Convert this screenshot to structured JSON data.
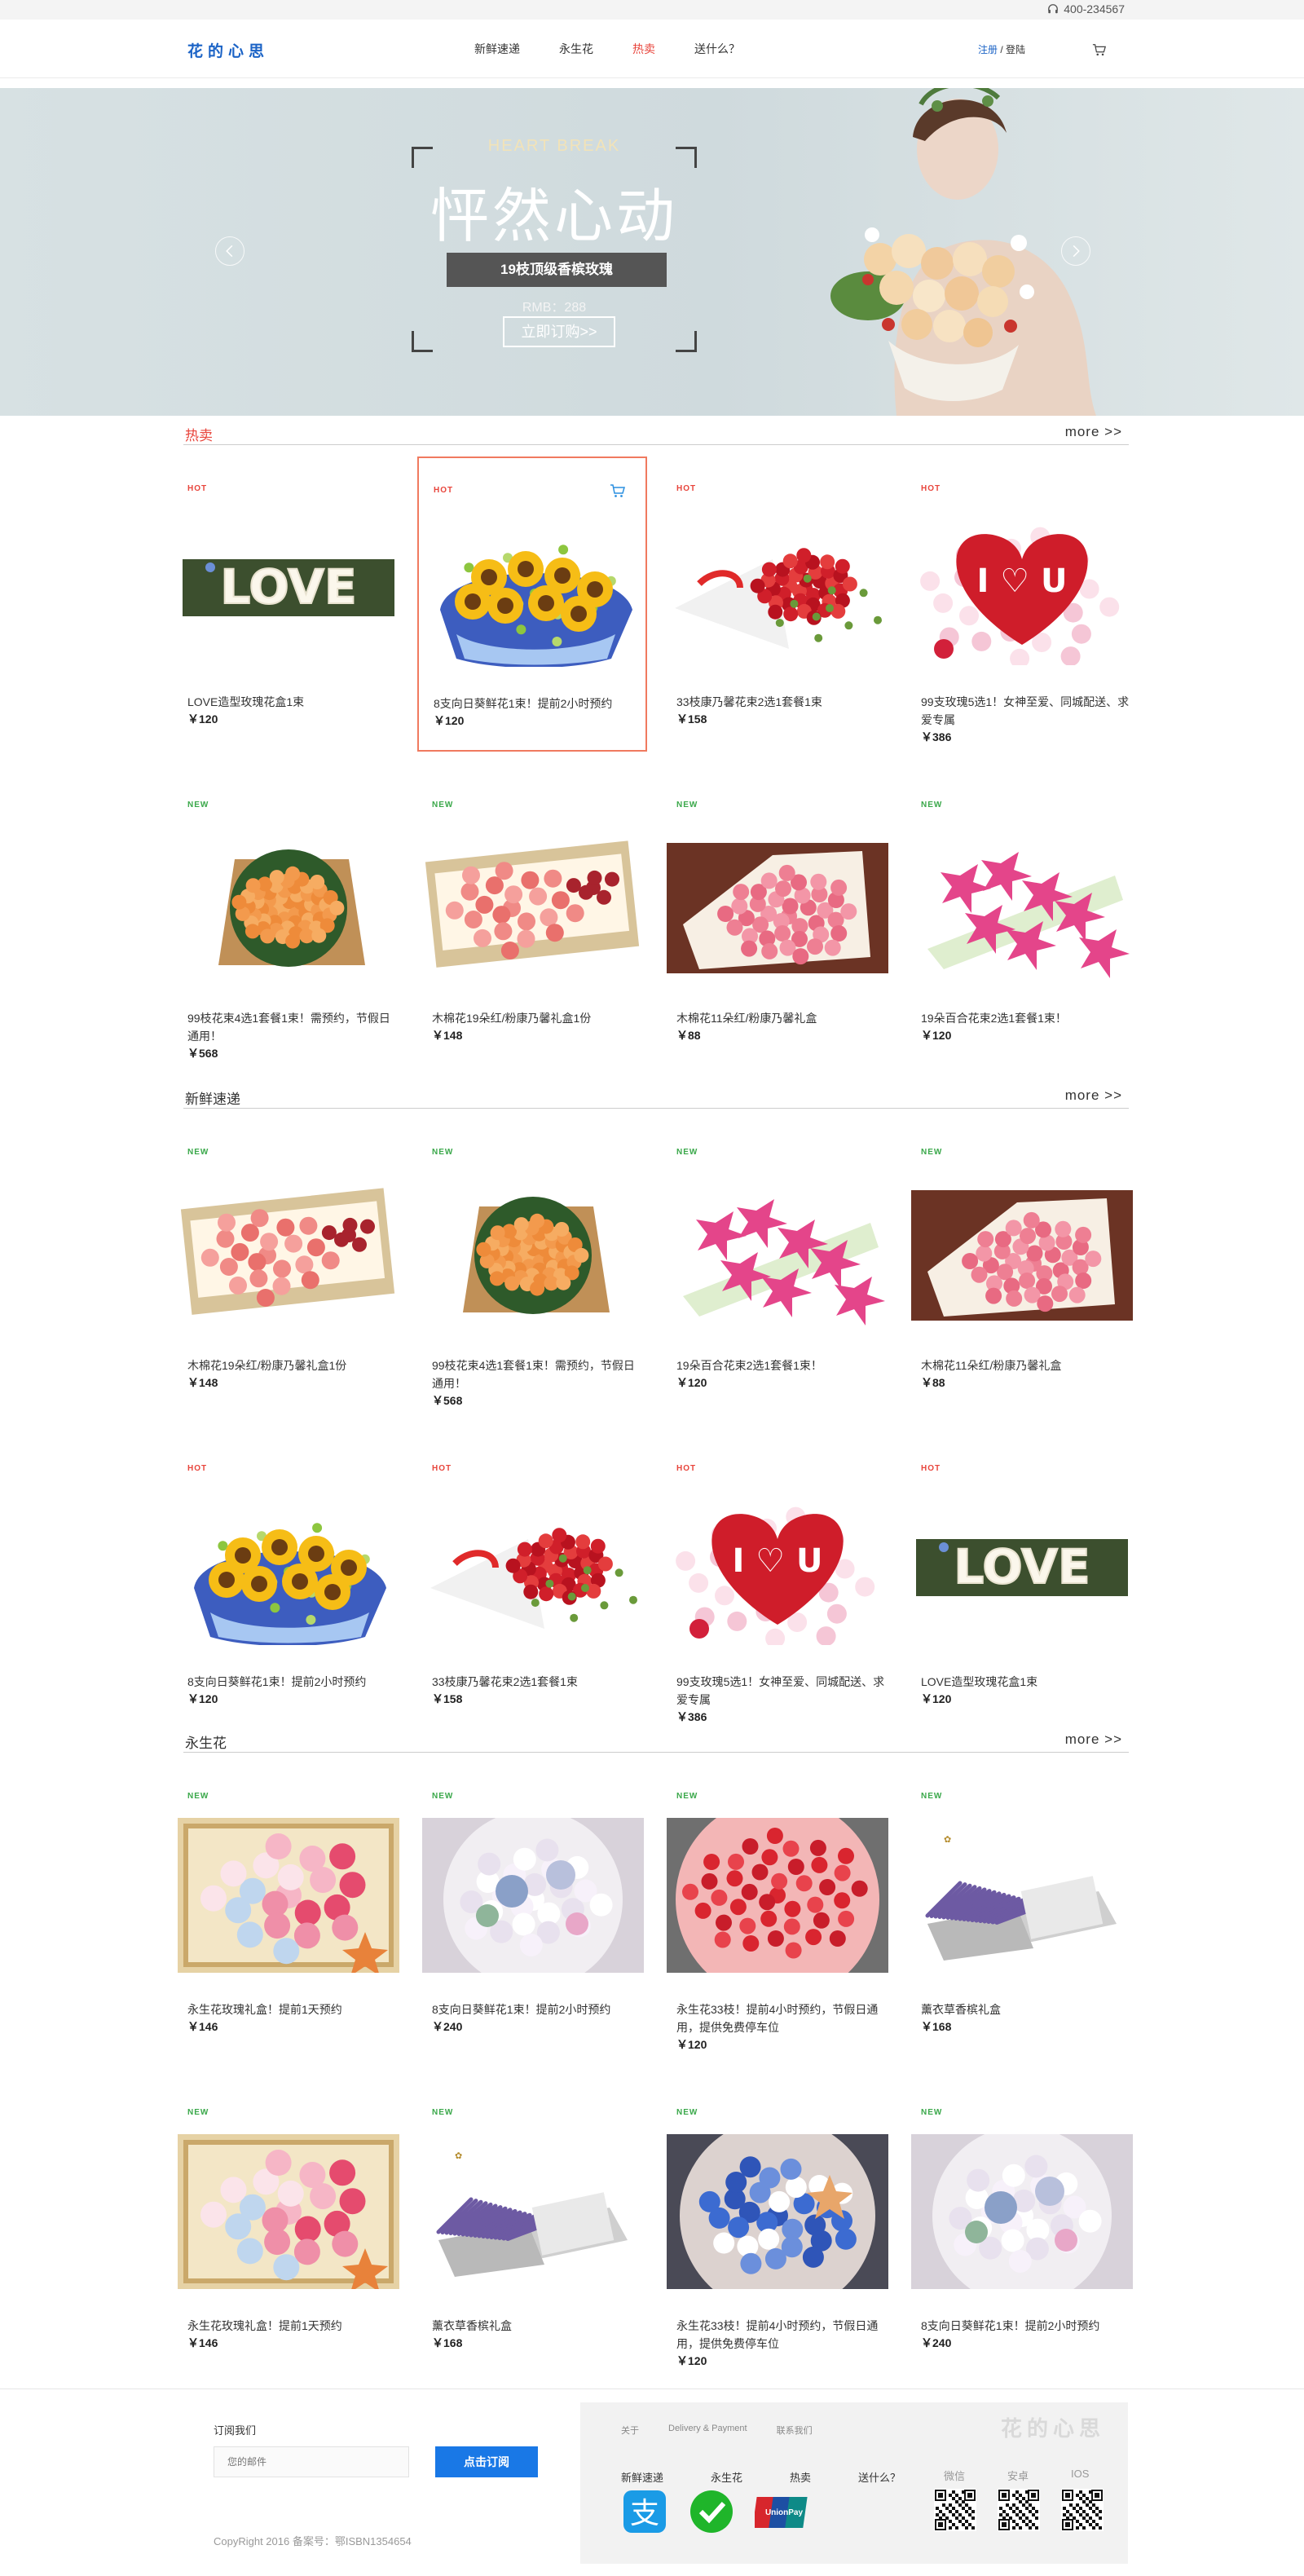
{
  "topbar": {
    "phone": "400-234567"
  },
  "header": {
    "logo": "花的心思",
    "nav": [
      {
        "label": "新鲜速递"
      },
      {
        "label": "永生花"
      },
      {
        "label": "热卖"
      },
      {
        "label": "送什么？"
      }
    ],
    "register": "注册",
    "separator": " / ",
    "login": "登陆"
  },
  "banner": {
    "eyebrow": "HEART BREAK",
    "title": "怦然心动",
    "product": "19枝顶级香槟玫瑰",
    "price": "RMB：288",
    "order_button": "立即订购>>"
  },
  "sections": [
    {
      "title": "热卖",
      "more": "more >>",
      "cards": [
        {
          "badge": "HOT",
          "name": "LOVE造型玫瑰花盒1束",
          "price": "￥120"
        },
        {
          "badge": "HOT",
          "name": "8支向日葵鲜花1束！提前2小时预约",
          "price": "￥120"
        },
        {
          "badge": "HOT",
          "name": "33枝康乃馨花束2选1套餐1束",
          "price": "￥158"
        },
        {
          "badge": "HOT",
          "name": "99支玫瑰5选1！女神至爱、同城配送、求爱专属",
          "price": "￥386"
        },
        {
          "badge": "NEW",
          "name": "99枝花束4选1套餐1束！需预约，节假日通用！",
          "price": "￥568"
        },
        {
          "badge": "NEW",
          "name": "木棉花19朵红/粉康乃馨礼盒1份",
          "price": "￥148"
        },
        {
          "badge": "NEW",
          "name": "木棉花11朵红/粉康乃馨礼盒",
          "price": "￥88"
        },
        {
          "badge": "NEW",
          "name": "19朵百合花束2选1套餐1束！",
          "price": "￥120"
        }
      ]
    },
    {
      "title": "新鲜速递",
      "more": "more >>",
      "cards": [
        {
          "badge": "NEW",
          "name": "木棉花19朵红/粉康乃馨礼盒1份",
          "price": "￥148"
        },
        {
          "badge": "NEW",
          "name": "99枝花束4选1套餐1束！需预约，节假日通用！",
          "price": "￥568"
        },
        {
          "badge": "NEW",
          "name": "19朵百合花束2选1套餐1束！",
          "price": "￥120"
        },
        {
          "badge": "NEW",
          "name": "木棉花11朵红/粉康乃馨礼盒",
          "price": "￥88"
        },
        {
          "badge": "HOT",
          "name": "8支向日葵鲜花1束！提前2小时预约",
          "price": "￥120"
        },
        {
          "badge": "HOT",
          "name": "33枝康乃馨花束2选1套餐1束",
          "price": "￥158"
        },
        {
          "badge": "HOT",
          "name": "99支玫瑰5选1！女神至爱、同城配送、求爱专属",
          "price": "￥386"
        },
        {
          "badge": "HOT",
          "name": "LOVE造型玫瑰花盒1束",
          "price": "￥120"
        }
      ]
    },
    {
      "title": "永生花",
      "more": "more >>",
      "cards": [
        {
          "badge": "NEW",
          "name": "永生花玫瑰礼盒！提前1天预约",
          "price": "￥146"
        },
        {
          "badge": "NEW",
          "name": "8支向日葵鲜花1束！提前2小时预约",
          "price": "￥240"
        },
        {
          "badge": "NEW",
          "name": "永生花33枝！提前4小时预约，节假日通用，提供免费停车位",
          "price": "￥120"
        },
        {
          "badge": "NEW",
          "name": "薰衣草香槟礼盒",
          "price": "￥168"
        },
        {
          "badge": "NEW",
          "name": "永生花玫瑰礼盒！提前1天预约",
          "price": "￥146"
        },
        {
          "badge": "NEW",
          "name": "薰衣草香槟礼盒",
          "price": "￥168"
        },
        {
          "badge": "NEW",
          "name": "永生花33枝！提前4小时预约，节假日通用，提供免费停车位",
          "price": "￥120"
        },
        {
          "badge": "NEW",
          "name": "8支向日葵鲜花1束！提前2小时预约",
          "price": "￥240"
        }
      ]
    }
  ],
  "footer": {
    "subscribe_label": "订阅我们",
    "email_placeholder": "您的邮件",
    "subscribe_button": "点击订阅",
    "copyright": "CopyRight 2016 备案号：鄂ISBN1354654",
    "links": [
      "关于",
      "Delivery & Payment",
      "联系我们"
    ],
    "logo": "花的心思",
    "nav": [
      "新鲜速递",
      "永生花",
      "热卖",
      "送什么？"
    ],
    "apps": [
      "微信",
      "安卓",
      "IOS"
    ],
    "payments": [
      "alipay-icon",
      "wechat-pay-icon",
      "unionpay-icon"
    ]
  },
  "colors": {
    "brand": "#1b63c6",
    "accent_red": "#e8453c",
    "new_green": "#3aa84a",
    "button_blue": "#1978e6"
  }
}
